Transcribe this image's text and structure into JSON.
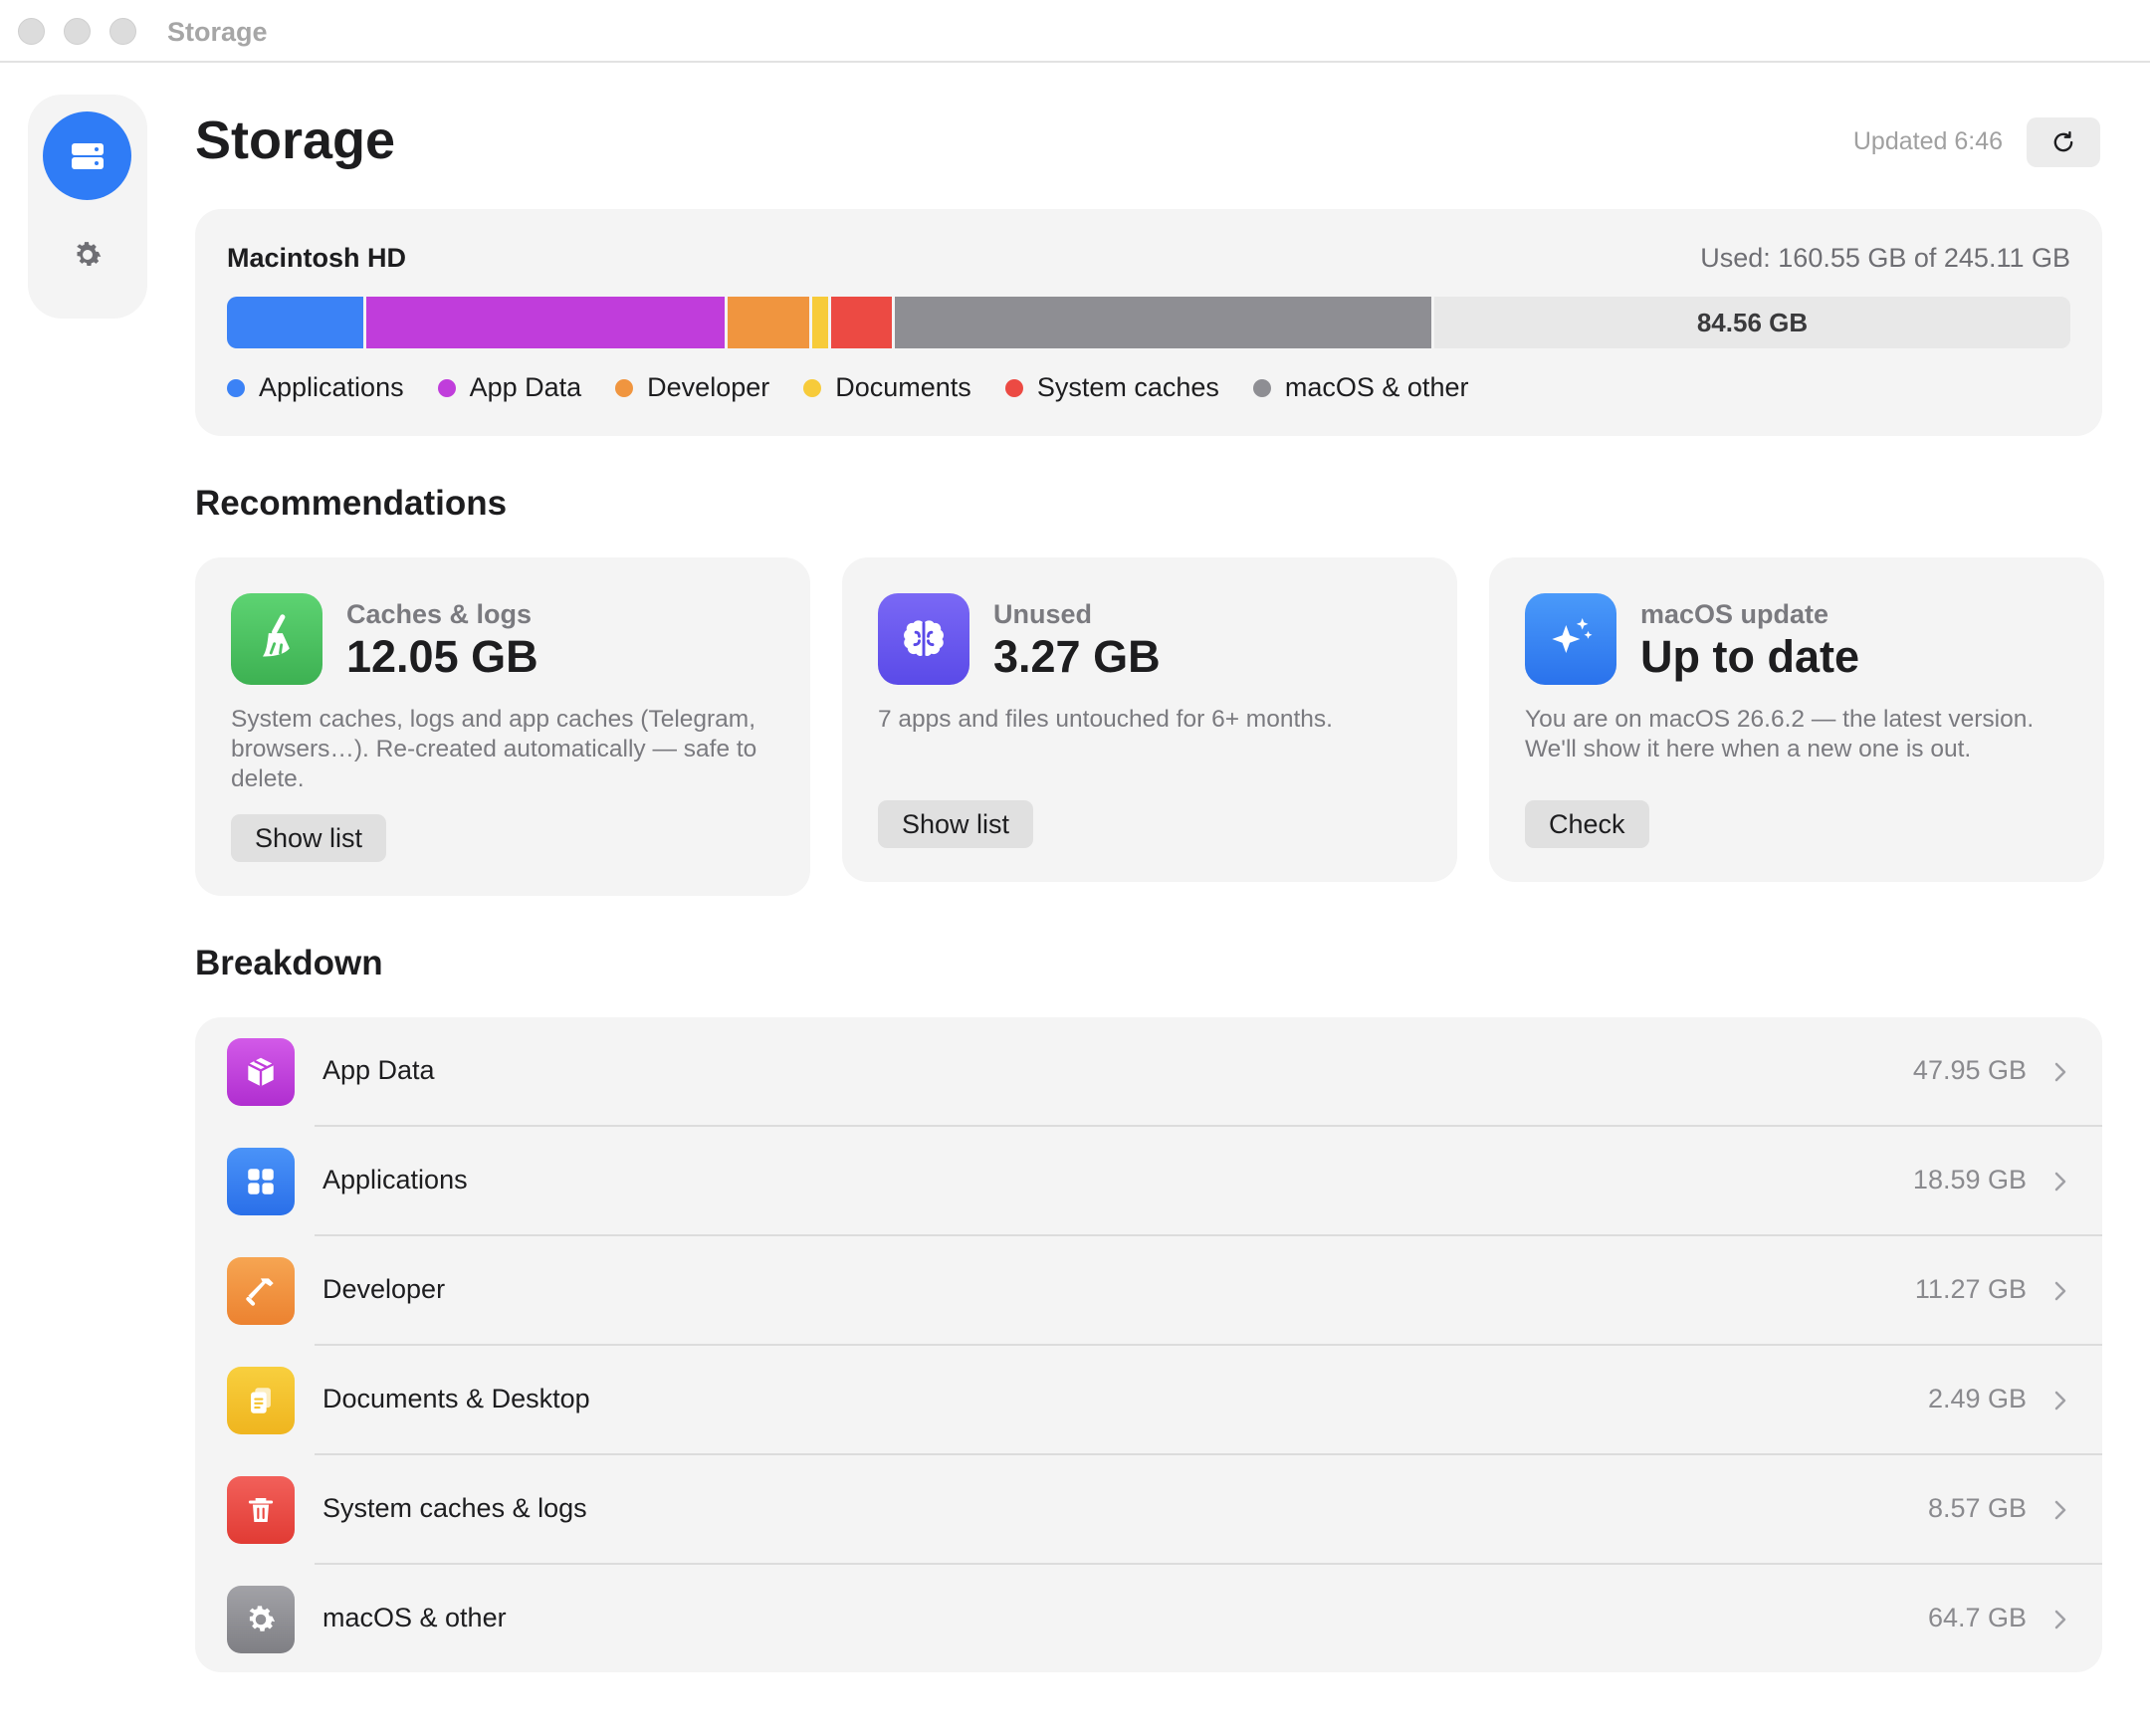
{
  "window": {
    "title": "Storage"
  },
  "header": {
    "title": "Storage",
    "updated": "Updated 6:46"
  },
  "disk": {
    "name": "Macintosh HD",
    "used_text": "Used: 160.55 GB of 245.11 GB",
    "total_gb": 245.11,
    "free_label": "84.56 GB",
    "free_gb": 84.56,
    "segments": [
      {
        "name": "Applications",
        "gb": 18.59,
        "color": "#3b82f6"
      },
      {
        "name": "App Data",
        "gb": 47.95,
        "color": "#c03ddb"
      },
      {
        "name": "Developer",
        "gb": 11.27,
        "color": "#f0953f"
      },
      {
        "name": "Documents",
        "gb": 2.49,
        "color": "#f7cb3a"
      },
      {
        "name": "System caches",
        "gb": 8.57,
        "color": "#ec4a43"
      },
      {
        "name": "macOS & other",
        "gb": 71.68,
        "color": "#8e8e93"
      }
    ],
    "legend": [
      {
        "label": "Applications",
        "color": "#3b82f6"
      },
      {
        "label": "App Data",
        "color": "#c03ddb"
      },
      {
        "label": "Developer",
        "color": "#f0953f"
      },
      {
        "label": "Documents",
        "color": "#f7cb3a"
      },
      {
        "label": "System caches",
        "color": "#ec4a43"
      },
      {
        "label": "macOS & other",
        "color": "#8e8e93"
      }
    ]
  },
  "recommendations": {
    "heading": "Recommendations",
    "cards": [
      {
        "label": "Caches & logs",
        "value": "12.05 GB",
        "description": "System caches, logs and app caches (Telegram, browsers…). Re-created automatically — safe to delete.",
        "button": "Show list",
        "icon": "broom-icon",
        "color": "#4cc361"
      },
      {
        "label": "Unused",
        "value": "3.27 GB",
        "description": "7 apps and files untouched for 6+ months.",
        "button": "Show list",
        "icon": "brain-icon",
        "color": "#6a5cf0"
      },
      {
        "label": "macOS update",
        "value": "Up to date",
        "description": "You are on macOS 26.6.2 — the latest version. We'll show it here when a new one is out.",
        "button": "Check",
        "icon": "sparkles-icon",
        "color": "#2f7cf6"
      }
    ]
  },
  "breakdown": {
    "heading": "Breakdown",
    "rows": [
      {
        "label": "App Data",
        "size": "47.95 GB",
        "icon": "package-icon",
        "color": "#c03ddb"
      },
      {
        "label": "Applications",
        "size": "18.59 GB",
        "icon": "app-grid-icon",
        "color": "#3b82f6"
      },
      {
        "label": "Developer",
        "size": "11.27 GB",
        "icon": "hammer-icon",
        "color": "#f0953f"
      },
      {
        "label": "Documents & Desktop",
        "size": "2.49 GB",
        "icon": "documents-icon",
        "color": "#f5c22c"
      },
      {
        "label": "System caches & logs",
        "size": "8.57 GB",
        "icon": "trash-icon",
        "color": "#ec4a43"
      },
      {
        "label": "macOS & other",
        "size": "64.7 GB",
        "icon": "gear-icon",
        "color": "#8e8e93"
      }
    ]
  }
}
